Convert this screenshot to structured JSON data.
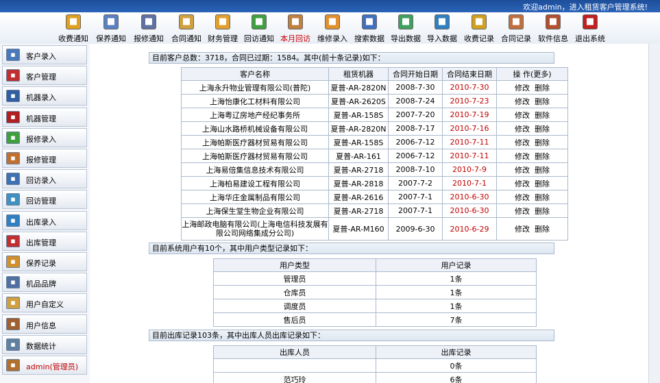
{
  "header": {
    "welcome": "欢迎admin，进入租赁客户管理系统!"
  },
  "toolbar": [
    {
      "label": "收费通知",
      "icon": "coins-bell-icon",
      "color": "#e0a020"
    },
    {
      "label": "保养通知",
      "icon": "notepad-icon",
      "color": "#5a80c0"
    },
    {
      "label": "报修通知",
      "icon": "tools-icon",
      "color": "#6070a0"
    },
    {
      "label": "合同通知",
      "icon": "envelope-icon",
      "color": "#d0a040"
    },
    {
      "label": "财务管理",
      "icon": "money-card-icon",
      "color": "#e0a030"
    },
    {
      "label": "回访通知",
      "icon": "house-arrow-icon",
      "color": "#40a040"
    },
    {
      "label": "本月回访",
      "icon": "house-calendar-icon",
      "color": "#c08040"
    },
    {
      "label": "维修录入",
      "icon": "repair-disc-icon",
      "color": "#e09030"
    },
    {
      "label": "搜索数据",
      "icon": "search-document-icon",
      "color": "#4070c0"
    },
    {
      "label": "导出数据",
      "icon": "export-user-icon",
      "color": "#40a060"
    },
    {
      "label": "导入数据",
      "icon": "import-globe-icon",
      "color": "#3080c0"
    },
    {
      "label": "收费记录",
      "icon": "coins-record-icon",
      "color": "#d0a020"
    },
    {
      "label": "合同记录",
      "icon": "contract-user-icon",
      "color": "#c07040"
    },
    {
      "label": "软件信息",
      "icon": "home-info-icon",
      "color": "#b05030"
    },
    {
      "label": "退出系统",
      "icon": "exit-icon",
      "color": "#c02020"
    }
  ],
  "toolbar_active": "本月回访",
  "sidebar": [
    {
      "label": "客户录入",
      "icon": "customer-add-icon",
      "color": "#4a78b8"
    },
    {
      "label": "客户管理",
      "icon": "customer-manage-icon",
      "color": "#c03030"
    },
    {
      "label": "机器录入",
      "icon": "machine-add-icon",
      "color": "#3060a0"
    },
    {
      "label": "机器管理",
      "icon": "machine-manage-icon",
      "color": "#b02020"
    },
    {
      "label": "报修录入",
      "icon": "repair-add-icon",
      "color": "#40a040"
    },
    {
      "label": "报修管理",
      "icon": "repair-manage-icon",
      "color": "#c07030"
    },
    {
      "label": "回访录入",
      "icon": "visit-add-icon",
      "color": "#4070b0"
    },
    {
      "label": "回访管理",
      "icon": "visit-manage-icon",
      "color": "#4090c0"
    },
    {
      "label": "出库录入",
      "icon": "stock-out-add-icon",
      "color": "#3080c0"
    },
    {
      "label": "出库管理",
      "icon": "stock-out-manage-icon",
      "color": "#c03030"
    },
    {
      "label": "保养记录",
      "icon": "maintenance-record-icon",
      "color": "#d09030"
    },
    {
      "label": "机品品牌",
      "icon": "brand-icon",
      "color": "#5070a0"
    },
    {
      "label": "用户自定义",
      "icon": "user-custom-icon",
      "color": "#d0a040"
    },
    {
      "label": "用户信息",
      "icon": "user-info-icon",
      "color": "#a06030"
    },
    {
      "label": "数据统计",
      "icon": "statistics-icon",
      "color": "#6080a0"
    },
    {
      "label": "admin(管理员)",
      "icon": "admin-home-icon",
      "color": "#b07030",
      "admin": true
    }
  ],
  "section1": {
    "summary": "目前客户总数：3718，合同已过期：1584。其中(前十条记录)如下：",
    "headers": [
      "客户名称",
      "租赁机器",
      "合同开始日期",
      "合同结束日期",
      "操 作(更多)"
    ],
    "edit_label": "修改",
    "delete_label": "删除",
    "rows": [
      {
        "name": "上海永升物业管理有限公司(普陀)",
        "machine": "夏普-AR-2820N",
        "start": "2008-7-30",
        "end": "2010-7-30"
      },
      {
        "name": "上海怡康化工材料有限公司",
        "machine": "夏普-AR-2620S",
        "start": "2008-7-24",
        "end": "2010-7-23"
      },
      {
        "name": "上海粤辽房地产经纪事务所",
        "machine": "夏普-AR-158S",
        "start": "2007-7-20",
        "end": "2010-7-19"
      },
      {
        "name": "上海山水路桥机械设备有限公司",
        "machine": "夏普-AR-2820N",
        "start": "2008-7-17",
        "end": "2010-7-16"
      },
      {
        "name": "上海帕斯医疗器材贸易有限公司",
        "machine": "夏普-AR-158S",
        "start": "2006-7-12",
        "end": "2010-7-11"
      },
      {
        "name": "上海帕斯医疗器材贸易有限公司",
        "machine": "夏普-AR-161",
        "start": "2006-7-12",
        "end": "2010-7-11"
      },
      {
        "name": "上海易倍集信息技术有限公司",
        "machine": "夏普-AR-2718",
        "start": "2008-7-10",
        "end": "2010-7-9"
      },
      {
        "name": "上海柏易建设工程有限公司",
        "machine": "夏普-AR-2818",
        "start": "2007-7-2",
        "end": "2010-7-1"
      },
      {
        "name": "上海华庄金属制品有限公司",
        "machine": "夏普-AR-2616",
        "start": "2007-7-1",
        "end": "2010-6-30"
      },
      {
        "name": "上海保生堂生物企业有限公司",
        "machine": "夏普-AR-2718",
        "start": "2007-7-1",
        "end": "2010-6-30"
      },
      {
        "name": "上海邮政电脑有限公司(上海电信科技发展有限公司网络集成分公司)",
        "machine": "夏普-AR-M160",
        "start": "2009-6-30",
        "end": "2010-6-29",
        "tall": true
      }
    ]
  },
  "section2": {
    "summary": "目前系统用户有10个，其中用户类型记录如下：",
    "headers": [
      "用户类型",
      "用户记录"
    ],
    "rows": [
      {
        "type": "管理员",
        "count": "1条"
      },
      {
        "type": "仓库员",
        "count": "1条"
      },
      {
        "type": "调度员",
        "count": "1条"
      },
      {
        "type": "售后员",
        "count": "7条"
      }
    ]
  },
  "section3": {
    "summary": "目前出库记录103条，其中出库人员出库记录如下：",
    "headers": [
      "出库人员",
      "出库记录"
    ],
    "rows": [
      {
        "person": "",
        "count": "0条"
      },
      {
        "person": "范巧玲",
        "count": "6条"
      }
    ]
  }
}
